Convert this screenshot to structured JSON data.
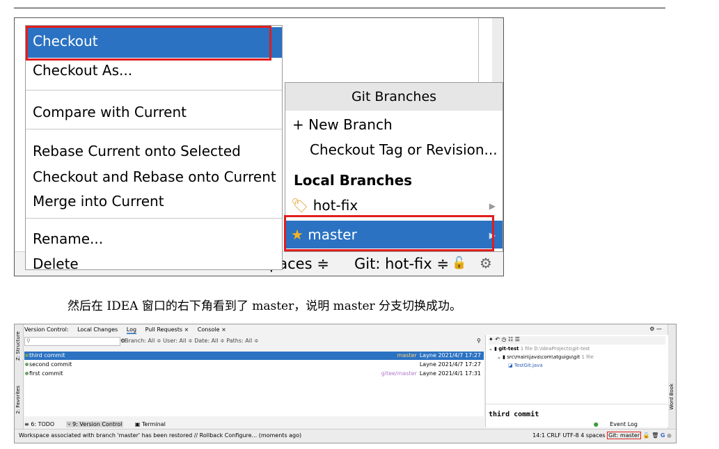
{
  "menu": {
    "items": [
      "Checkout",
      "Checkout As...",
      "Compare with Current",
      "Rebase Current onto Selected",
      "Checkout and Rebase onto Current",
      "Merge into Current",
      "Rename...",
      "Delete"
    ]
  },
  "branches_popup": {
    "title": "Git Branches",
    "new_branch": "New Branch",
    "checkout_tag": "Checkout Tag or Revision...",
    "local_header": "Local Branches",
    "hot_fix": "hot-fix",
    "master": "master"
  },
  "status_top": {
    "spaces": "spaces ≑",
    "git": "Git: hot-fix ≑"
  },
  "caption": "然后在 IDEA 窗口的右下角看到了 master，说明 master 分支切换成功。",
  "ide": {
    "tabs": [
      "Version Control:",
      "Local Changes",
      "Log",
      "Pull Requests ×",
      "Console ×"
    ],
    "left_tools": [
      "Z: Structure",
      "2: Favorites"
    ],
    "right_tool": "Word Book",
    "filters": "Branch: All ≑  User: All ≑  Date: All ≑  Paths: All ≑",
    "commits": [
      {
        "message": "third commit",
        "ref": "master",
        "author": "Layne",
        "date": "2021/4/7 17:27"
      },
      {
        "message": "second commit",
        "ref": "",
        "author": "Layne",
        "date": "2021/4/7 17:27"
      },
      {
        "message": "first commit",
        "ref": "gitee/master",
        "author": "Layne",
        "date": "2021/4/1 17:31"
      }
    ],
    "tree": {
      "root": "git-test",
      "root_meta": "1 file  D:\\IdeaProjects\\git-test",
      "path": "src\\main\\java\\com\\atguigu\\git",
      "path_meta": "1 file",
      "file": "TestGit.java"
    },
    "commit_message": "third commit",
    "bottom_tabs": [
      "≡ 6: TODO",
      "⑂ 9: Version Control",
      "▣ Terminal"
    ],
    "event_log": "Event Log",
    "status_left": "Workspace associated with branch 'master' has been restored // Rollback   Configure... (moments ago)",
    "status_right": "14:1  CRLF  UTF-8  4 spaces",
    "git_branch": "Git: master"
  }
}
